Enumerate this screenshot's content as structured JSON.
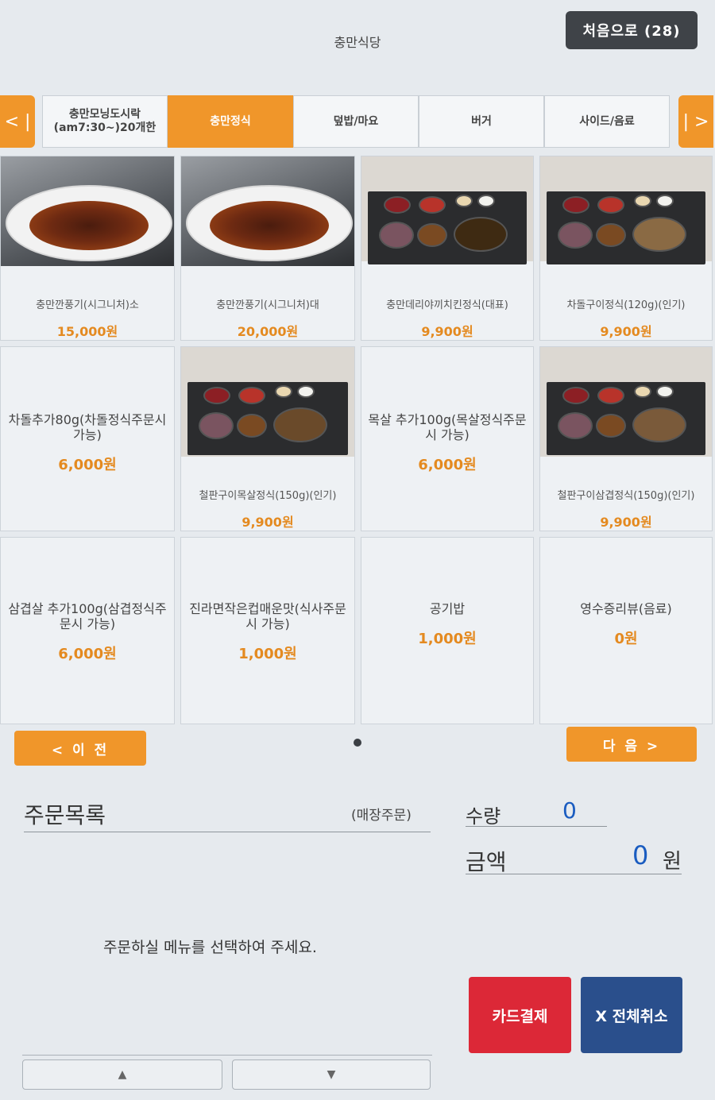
{
  "header": {
    "store_name": "충만식당",
    "home_button": "처음으로 (28)"
  },
  "tabs": {
    "prev_arrow": "< |",
    "next_arrow": "| >",
    "items": [
      {
        "label": "충만모닝도시락\n(am7:30~)20개한",
        "active": false
      },
      {
        "label": "충만정식",
        "active": true
      },
      {
        "label": "덮밥/마요",
        "active": false
      },
      {
        "label": "버거",
        "active": false
      },
      {
        "label": "사이드/음료",
        "active": false
      }
    ]
  },
  "menu": [
    {
      "name": "충만깐풍기(시그니처)소",
      "price": "15,000원"
    },
    {
      "name": "충만깐풍기(시그니처)대",
      "price": "20,000원"
    },
    {
      "name": "충만데리야끼치킨정식(대표)",
      "price": "9,900원"
    },
    {
      "name": "차돌구이정식(120g)(인기)",
      "price": "9,900원"
    },
    {
      "name": "차돌추가80g(차돌정식주문시 가능)",
      "price": "6,000원"
    },
    {
      "name": "철판구이목살정식(150g)(인기)",
      "price": "9,900원"
    },
    {
      "name": "목살 추가100g(목살정식주문시 가능)",
      "price": "6,000원"
    },
    {
      "name": "철판구이삼겹정식(150g)(인기)",
      "price": "9,900원"
    },
    {
      "name": "삼겹살 추가100g(삼겹정식주문시 가능)",
      "price": "6,000원"
    },
    {
      "name": "진라면작은컵매운맛(식사주문시 가능)",
      "price": "1,000원"
    },
    {
      "name": "공기밥",
      "price": "1,000원"
    },
    {
      "name": "영수증리뷰(음료)",
      "price": "0원"
    }
  ],
  "pagination": {
    "prev_label": "< 이 전",
    "next_label": "다 음 >"
  },
  "order": {
    "title": "주문목록",
    "type": "(매장주문)",
    "qty_label": "수량",
    "qty_value": "0",
    "amount_label": "금액",
    "amount_value": "0",
    "amount_unit": "원",
    "empty_message": "주문하실 메뉴를 선택하여 주세요.",
    "pay_button": "카드결제",
    "cancel_button": "X 전체취소",
    "scroll_up": "▲",
    "scroll_down": "▼"
  },
  "colors": {
    "accent": "#f0962a",
    "pay": "#dc2837",
    "cancel": "#2a4f8c",
    "price": "#e48a20",
    "value": "#1a5cc0"
  }
}
